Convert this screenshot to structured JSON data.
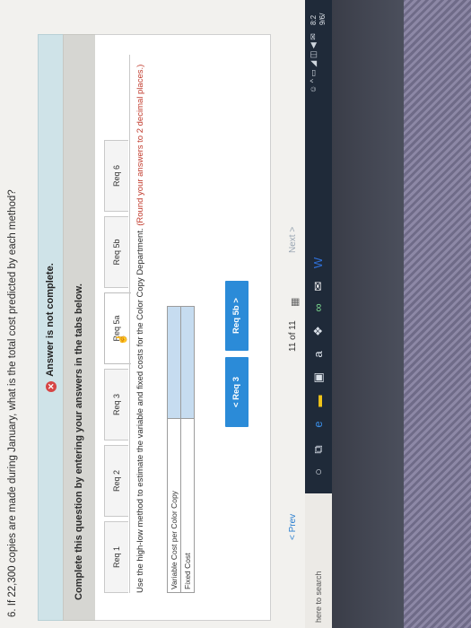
{
  "question": "6. If 22,300 copies are made during January, what is the total cost predicted by each method?",
  "status": {
    "text": "Answer is not complete.",
    "icon": "error-x-icon",
    "color": "#d64545"
  },
  "instruction": "Complete this question by entering your answers in the tabs below.",
  "tabs": [
    {
      "label": "Req 1"
    },
    {
      "label": "Req 2"
    },
    {
      "label": "Req 3"
    },
    {
      "label": "Req 5a"
    },
    {
      "label": "Req 5b"
    },
    {
      "label": "Req 6"
    }
  ],
  "active_tab": "Req 5a",
  "task": {
    "main": "Use the high-low method to estimate the variable and fixed costs for the Color Copy Department.",
    "hint": "(Round your answers to 2 decimal places.)"
  },
  "table": {
    "rows": [
      {
        "label": "Variable Cost per Color Copy",
        "value": ""
      },
      {
        "label": "Fixed Cost",
        "value": ""
      }
    ]
  },
  "buttons": {
    "prev_req": "< Req 3",
    "next_req": "Req 5b >"
  },
  "pager": {
    "prev": "< Prev",
    "count": "11 of 11",
    "next": "Next >"
  },
  "taskbar": {
    "search_placeholder": "here to search",
    "clock_time": "8:2",
    "clock_date": "9/6/"
  },
  "colors": {
    "accent": "#2b8bd8",
    "status_bg": "#cfe3e8",
    "input_bg": "#c6dcf0"
  }
}
